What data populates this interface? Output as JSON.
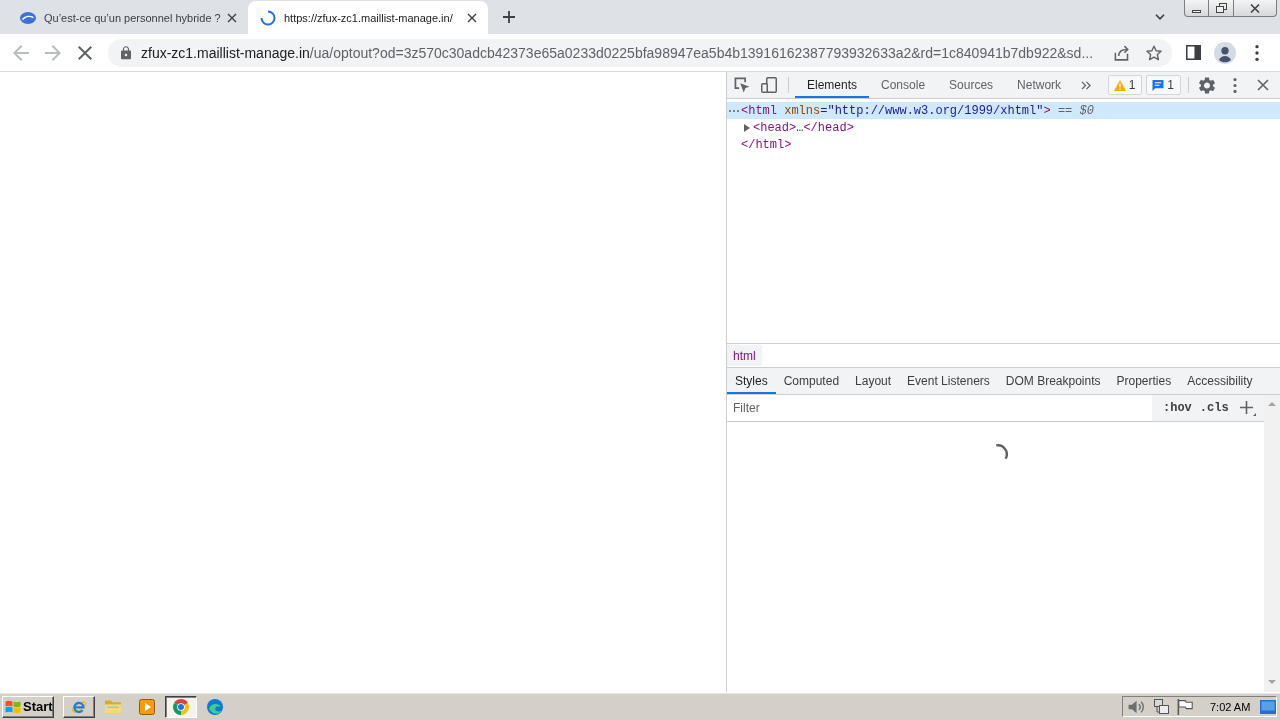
{
  "browser_tabs": [
    {
      "title": "Qu’est-ce qu’un personnel hybride ?",
      "selected": false,
      "loading": false
    },
    {
      "title": "https://zfux-zc1.maillist-manage.in/",
      "selected": true,
      "loading": true
    }
  ],
  "toolbar": {
    "back_disabled": true,
    "forward_disabled": true,
    "loading": true
  },
  "address_bar": {
    "secure": true,
    "host": "zfux-zc1.maillist-manage.in",
    "path": "/ua/optout?od=3z570c30adcb42373e65a0233d0225bfa98947ea5b4b13916162387793932633a2&rd=1c840941b7db922&sd..."
  },
  "devtools": {
    "tabs": [
      {
        "label": "Elements",
        "selected": true
      },
      {
        "label": "Console",
        "selected": false
      },
      {
        "label": "Sources",
        "selected": false
      },
      {
        "label": "Network",
        "selected": false
      }
    ],
    "badges": [
      {
        "kind": "warning",
        "count": "1"
      },
      {
        "kind": "message",
        "count": "1"
      }
    ],
    "dom_tree": [
      {
        "selected": true,
        "parts": [
          {
            "kind": "tag",
            "text": "<html"
          },
          {
            "kind": "attr_name",
            "text": " xmlns"
          },
          {
            "kind": "attr_value",
            "text": "=\"http://www.w3.org/1999/xhtml\""
          },
          {
            "kind": "tag",
            "text": ">"
          },
          {
            "kind": "marker",
            "text": " == *$0*"
          }
        ],
        "children": [
          {
            "selected": false,
            "expanded": false,
            "parts": [
              {
                "kind": "tag",
                "text": "<head>"
              },
              {
                "kind": "ellipsis",
                "text": "…"
              },
              {
                "kind": "tag",
                "text": "</head>"
              }
            ]
          }
        ],
        "closing": [
          {
            "kind": "tag",
            "text": "</html>"
          }
        ]
      }
    ],
    "breadcrumbs": [
      {
        "label": "html"
      }
    ],
    "sidebar_tabs": [
      {
        "label": "Styles",
        "selected": true
      },
      {
        "label": "Computed",
        "selected": false
      },
      {
        "label": "Layout",
        "selected": false
      },
      {
        "label": "Event Listeners",
        "selected": false
      },
      {
        "label": "DOM Breakpoints",
        "selected": false
      },
      {
        "label": "Properties",
        "selected": false
      },
      {
        "label": "Accessibility",
        "selected": false
      }
    ],
    "filter": {
      "placeholder": "Filter"
    },
    "filter_toggles": [
      ":hov",
      ".cls"
    ],
    "styles_loading": true
  },
  "taskbar": {
    "start_label": "Start",
    "items": [
      {
        "kind": "button",
        "selected": false
      },
      {
        "kind": "shortcut",
        "selected": false
      },
      {
        "kind": "shortcut",
        "selected": false
      },
      {
        "kind": "button",
        "selected": true
      },
      {
        "kind": "shortcut",
        "selected": false
      }
    ],
    "clock": "7:02 AM"
  }
}
